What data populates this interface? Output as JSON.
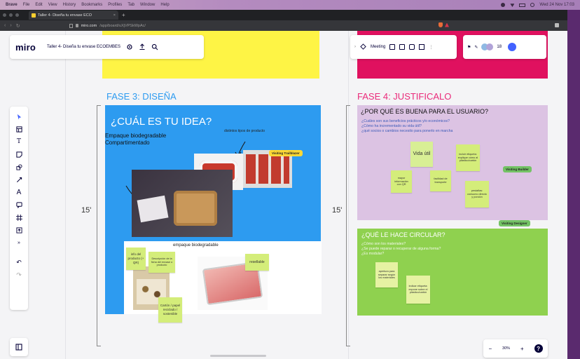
{
  "menubar": {
    "items": [
      "Brave",
      "File",
      "Edit",
      "View",
      "History",
      "Bookmarks",
      "Profiles",
      "Tab",
      "Window",
      "Help"
    ],
    "clock": "Wed 24 Nov 17:03"
  },
  "browser": {
    "tab_title": "Taller 4- Diseña tu envase ECO",
    "url_domain": "miro.com",
    "url_path": "/app/board/uXjVPSkWpAc/"
  },
  "miro": {
    "logo": "miro",
    "board_name": "Taller 4- Diseña tu envase ECOEMBES",
    "meeting_label": "Meeting",
    "collaborator_count": "18",
    "zoom": "30%",
    "help": "?"
  },
  "board": {
    "frame3_title": "FASE 3: DISEÑA",
    "frame4_title": "FASE 4: JUSTIFICALO",
    "timer_left": "15'",
    "timer_right": "15'",
    "idea_title": "¿CUÁL ES TU IDEA?",
    "idea_note": "Empaque biodegradable\nCompartimentado",
    "idea_note2": "distintos tipos de producto",
    "empaque_label": "empaque biodegradable",
    "sticky_info": "info del producto (+ QR)",
    "sticky_desc": "Descripción de la ficha del envase o producto",
    "sticky_carton": "Cartón / papel reciclado / sostenible",
    "sticky_reseal": "resellable",
    "user_q_title": "¿POR QUÉ ES BUENA PARA EL USUARIO?",
    "user_q_lines": [
      "¿Cuáles son sus beneficios prácticos y/o económicos?",
      "¿Cómo ha incrementado su vida útil?",
      "¿qué socios o cambios necesito para ponerlo en marcha"
    ],
    "circ_title": "¿QUÉ LE HACE CIRCULAR?",
    "circ_lines": [
      "¿Cómo son los materiales?",
      "¿Se puede reparar o recuperar de alguna forma?",
      "¿Es modular?"
    ],
    "sticky_vida": "Vida útil",
    "sticky_etiq": "incluir etiqueta: explique cómo al plástico/cartón",
    "sticky_mayor": "mayor información con QR",
    "sticky_facil": "facilidad de transporte",
    "sticky_pestanas": "pestañas: consumo directo y porción",
    "sticky_separar": "apertura para separar según los materiales",
    "sticky_indicar": "indicar etiqueta: expone sobre el plástico/cartón",
    "cursors": {
      "trailblazer": "Visiting Trailblazer",
      "builder": "Visiting Builder",
      "designer": "Visiting Designer"
    }
  },
  "colors": {
    "accent_blue": "#2d9bf0",
    "yellow": "#fef445",
    "magenta": "#e0115f",
    "pink": "#dcc3e3",
    "green": "#8fd14f",
    "title_pink": "#ea2a7a",
    "miro_navy": "#050038"
  }
}
